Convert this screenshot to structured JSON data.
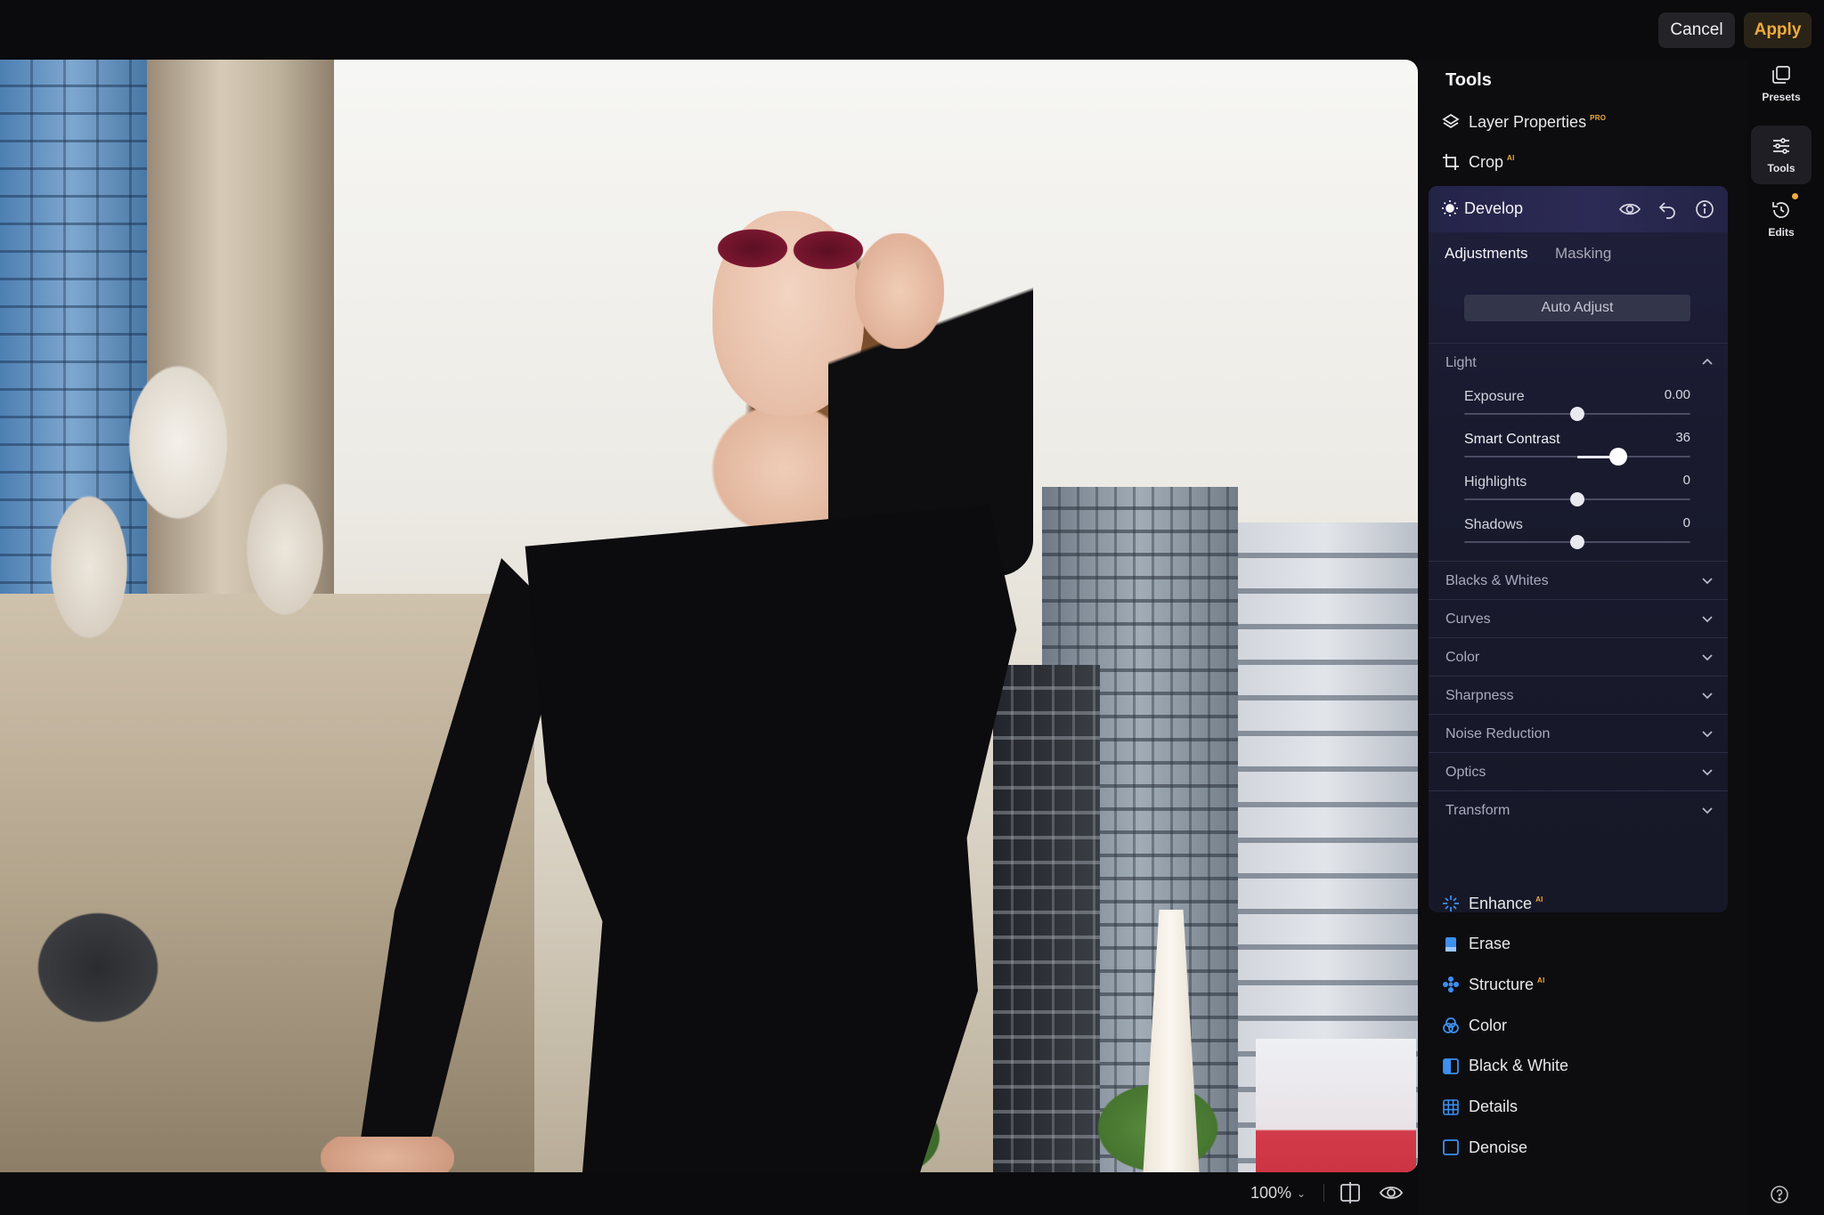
{
  "topbar": {
    "cancel_label": "Cancel",
    "apply_label": "Apply",
    "apply_color": "#f1ab3c"
  },
  "canvas": {
    "zoom_level": "100%"
  },
  "panel": {
    "title": "Tools",
    "tools_top": [
      {
        "label": "Layer Properties",
        "badge": "PRO",
        "icon": "layers-icon"
      },
      {
        "label": "Crop",
        "badge": "AI",
        "icon": "crop-icon"
      }
    ],
    "develop": {
      "title": "Develop",
      "tabs": [
        {
          "label": "Adjustments",
          "active": true
        },
        {
          "label": "Masking",
          "active": false
        }
      ],
      "auto_adjust_label": "Auto Adjust",
      "light_section": "Light",
      "sliders": [
        {
          "label": "Exposure",
          "value": "0.00",
          "position": 0.5
        },
        {
          "label": "Smart Contrast",
          "value": "36",
          "position": 0.68
        },
        {
          "label": "Highlights",
          "value": "0",
          "position": 0.5
        },
        {
          "label": "Shadows",
          "value": "0",
          "position": 0.5
        }
      ],
      "sections": [
        "Blacks & Whites",
        "Curves",
        "Color",
        "Sharpness",
        "Noise Reduction",
        "Optics",
        "Transform"
      ]
    },
    "tools_bottom": [
      {
        "label": "Enhance",
        "badge": "AI",
        "icon": "enhance-icon"
      },
      {
        "label": "Erase",
        "badge": "",
        "icon": "erase-icon"
      },
      {
        "label": "Structure",
        "badge": "AI",
        "icon": "structure-icon"
      },
      {
        "label": "Color",
        "badge": "",
        "icon": "color-icon"
      },
      {
        "label": "Black & White",
        "badge": "",
        "icon": "black-white-icon"
      },
      {
        "label": "Details",
        "badge": "",
        "icon": "details-icon"
      },
      {
        "label": "Denoise",
        "badge": "",
        "icon": "denoise-icon"
      }
    ]
  },
  "rail": {
    "items": [
      {
        "label": "Presets",
        "icon": "presets-icon",
        "active": false
      },
      {
        "label": "Tools",
        "icon": "tools-icon",
        "active": true
      },
      {
        "label": "Edits",
        "icon": "edits-icon",
        "active": false
      }
    ]
  }
}
